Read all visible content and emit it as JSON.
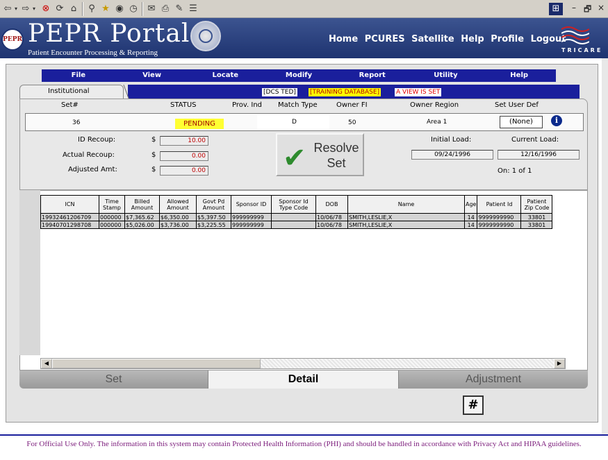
{
  "browser": {
    "icons": [
      "back-icon",
      "forward-icon",
      "stop-icon",
      "refresh-icon",
      "home-icon",
      "search-icon",
      "favorites-icon",
      "media-icon",
      "history-icon",
      "mail-icon",
      "print-icon",
      "edit-icon",
      "discuss-icon"
    ],
    "window_controls": [
      "–",
      "🗗",
      "×"
    ]
  },
  "header": {
    "logo_badge": "PEPR",
    "title": "PEPR Portal",
    "subtitle": "Patient Encounter Processing & Reporting",
    "nav": [
      "Home",
      "PCURES",
      "Satellite",
      "Help",
      "Profile",
      "Logout"
    ],
    "brand": "TRICARE"
  },
  "menu": [
    "File",
    "View",
    "Locate",
    "Modify",
    "Report",
    "Utility",
    "Help"
  ],
  "tab": {
    "label": "Institutional",
    "banners": {
      "dcs": "[DCS TED]",
      "training": "[TRAINING DATABASE]",
      "view": "A VIEW IS SET"
    }
  },
  "set": {
    "headers": {
      "set_no": "Set#",
      "status": "STATUS",
      "prov_ind": "Prov. Ind",
      "match_type": "Match Type",
      "owner_fi": "Owner FI",
      "owner_region": "Owner Region",
      "set_user_def": "Set User Def"
    },
    "values": {
      "set_no": "36",
      "status": "PENDING",
      "match_type": "D",
      "owner_fi": "50",
      "owner_region": "Area 1",
      "set_user_def": "(None)"
    }
  },
  "amounts": {
    "id_recoup_label": "ID Recoup:",
    "id_recoup_value": "10.00",
    "actual_recoup_label": "Actual Recoup:",
    "actual_recoup_value": "0.00",
    "adjusted_amt_label": "Adjusted Amt:",
    "adjusted_amt_value": "0.00",
    "currency": "$"
  },
  "resolve": {
    "line1": "Resolve",
    "line2": "Set"
  },
  "loads": {
    "initial_label": "Initial Load:",
    "initial_value": "09/24/1996",
    "current_label": "Current Load:",
    "current_value": "12/16/1996",
    "position": "On: 1 of 1"
  },
  "grid": {
    "columns": [
      "ICN",
      "Time Stamp",
      "Billed Amount",
      "Allowed Amount",
      "Govt Pd Amount",
      "Sponsor ID",
      "Sponsor Id Type Code",
      "DOB",
      "Name",
      "Age",
      "Patient Id",
      "Patient Zip Code"
    ],
    "rows": [
      [
        "19932461206709",
        "000000",
        "$7,365.62",
        "$6,350.00",
        "$5,397.50",
        "999999999",
        "",
        "10/06/78",
        "SMITH,LESLIE,X",
        "14",
        "9999999990",
        "33801"
      ],
      [
        "19940701298708",
        "000000",
        "$5,026.00",
        "$3,736.00",
        "$3,225.55",
        "999999999",
        "",
        "10/06/78",
        "SMITH,LESLIE,X",
        "14",
        "9999999990",
        "33801"
      ]
    ]
  },
  "bottom_tabs": {
    "set": "Set",
    "detail": "Detail",
    "adjustment": "Adjustment"
  },
  "hash_button": "#",
  "footer": "For Official Use Only. The information in this system may contain Protected Health Information (PHI) and should be handled in accordance with Privacy Act and HIPAA guidelines."
}
